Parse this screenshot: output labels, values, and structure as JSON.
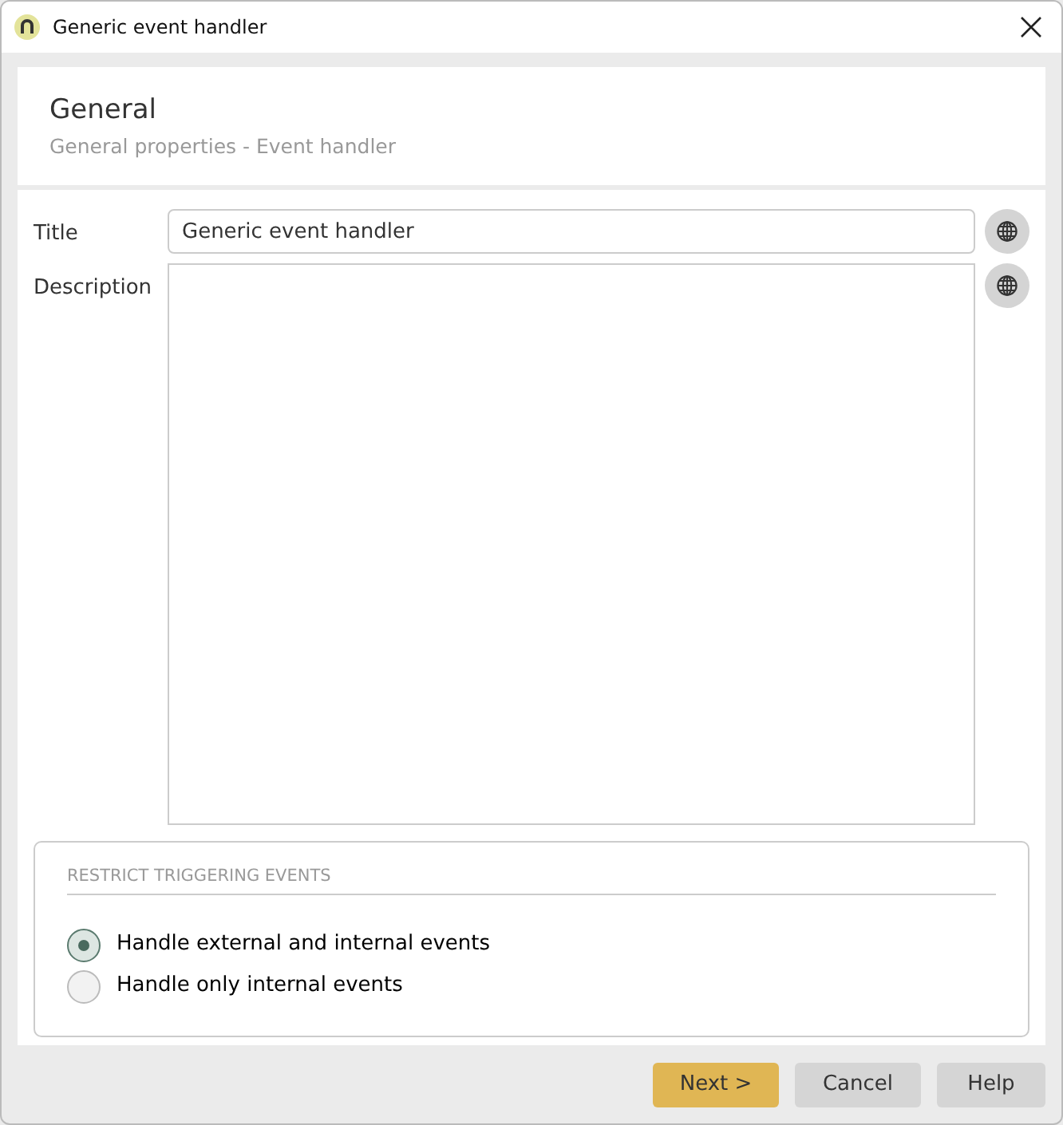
{
  "window": {
    "title": "Generic event handler"
  },
  "header": {
    "title": "General",
    "subtitle": "General properties - Event handler"
  },
  "fields": [
    {
      "label": "Title",
      "value": "Generic event handler",
      "kind": "text"
    },
    {
      "label": "Description",
      "kind": "textarea"
    }
  ],
  "restrict": {
    "heading": "RESTRICT TRIGGERING EVENTS",
    "options": [
      {
        "label": "Handle external and internal events",
        "selected": true
      },
      {
        "label": "Handle only internal events",
        "selected": false
      }
    ]
  },
  "buttons": [
    {
      "label": "Next >",
      "kind": "primary"
    },
    {
      "label": "Cancel",
      "kind": "secondary"
    },
    {
      "label": "Help",
      "kind": "secondary"
    }
  ]
}
